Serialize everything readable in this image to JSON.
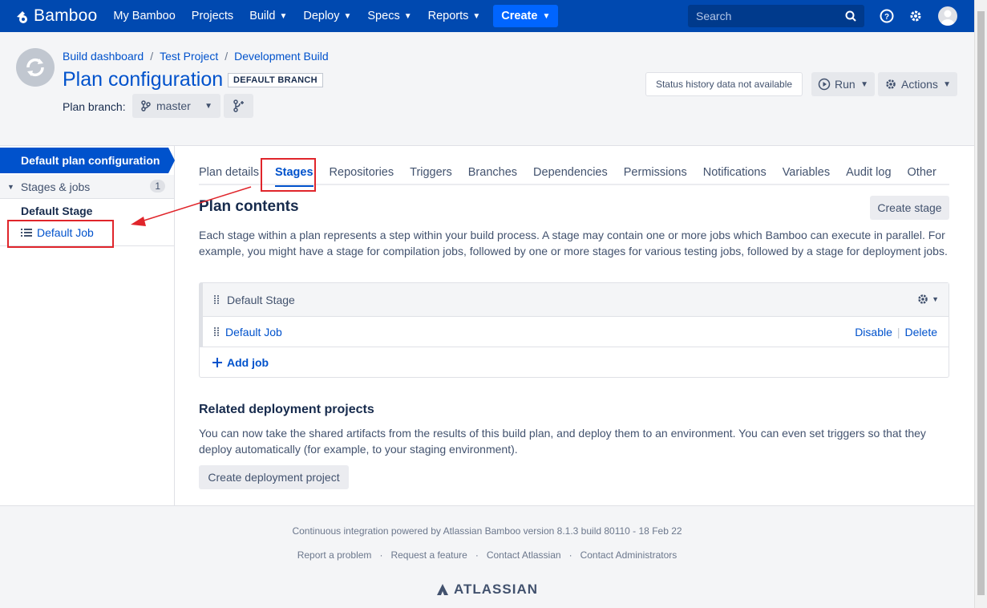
{
  "topnav": {
    "brand": "Bamboo",
    "items": [
      {
        "label": "My Bamboo",
        "dropdown": false
      },
      {
        "label": "Projects",
        "dropdown": false
      },
      {
        "label": "Build",
        "dropdown": true
      },
      {
        "label": "Deploy",
        "dropdown": true
      },
      {
        "label": "Specs",
        "dropdown": true
      },
      {
        "label": "Reports",
        "dropdown": true
      }
    ],
    "create_label": "Create",
    "search_placeholder": "Search",
    "bg_color": "#0049b0"
  },
  "header": {
    "breadcrumb": [
      "Build dashboard",
      "Test Project",
      "Development Build"
    ],
    "separator": "/",
    "title": "Plan configuration",
    "badge": "DEFAULT BRANCH",
    "plan_branch_label": "Plan branch:",
    "branch_value": "master",
    "status_text": "Status history data not available",
    "run_label": "Run",
    "actions_label": "Actions"
  },
  "sidebar": {
    "active_item": "Default plan configuration",
    "group_label": "Stages & jobs",
    "group_count": "1",
    "stage_label": "Default Stage",
    "job_label": "Default Job"
  },
  "main": {
    "tabs": [
      "Plan details",
      "Stages",
      "Repositories",
      "Triggers",
      "Branches",
      "Dependencies",
      "Permissions",
      "Notifications",
      "Variables",
      "Audit log",
      "Other"
    ],
    "active_tab": "Stages",
    "plan_contents_title": "Plan contents",
    "create_stage_label": "Create stage",
    "plan_contents_desc": "Each stage within a plan represents a step within your build process. A stage may contain one or more jobs which Bamboo can execute in parallel. For example, you might have a stage for compilation jobs, followed by one or more stages for various testing jobs, followed by a stage for deployment jobs.",
    "stage_name": "Default Stage",
    "job_name": "Default Job",
    "disable_label": "Disable",
    "delete_label": "Delete",
    "action_separator": "|",
    "add_job_label": "Add job",
    "related_title": "Related deployment projects",
    "related_desc": "You can now take the shared artifacts from the results of this build plan, and deploy them to an environment. You can even set triggers so that they deploy automatically (for example, to your staging environment).",
    "create_deployment_label": "Create deployment project"
  },
  "footer": {
    "powered_by": "Continuous integration powered by Atlassian Bamboo version 8.1.3 build 80110 - 18 Feb 22",
    "links": [
      "Report a problem",
      "Request a feature",
      "Contact Atlassian",
      "Contact Administrators"
    ],
    "link_separator": "·",
    "logo_text": "ATLASSIAN"
  },
  "annotation_color": "#e0252b"
}
